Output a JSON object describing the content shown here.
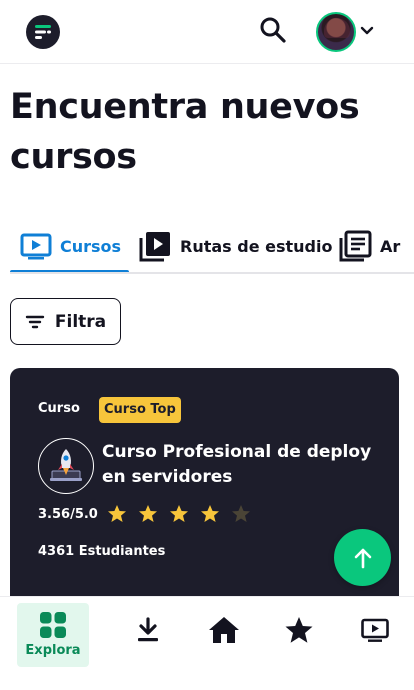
{
  "header": {
    "logo_icon": "platzi-logo-icon",
    "search_icon": "search-icon",
    "avatar_icon": "user-avatar",
    "chevron_icon": "chevron-down-icon"
  },
  "page": {
    "title": "Encuentra nuevos cursos"
  },
  "tabs": [
    {
      "label": "Cursos",
      "icon": "play-video-icon",
      "active": true
    },
    {
      "label": "Rutas de estudio",
      "icon": "playlist-icon",
      "active": false
    },
    {
      "label": "Ar",
      "icon": "articles-icon",
      "active": false
    }
  ],
  "filter": {
    "label": "Filtra",
    "icon": "filter-icon"
  },
  "course_card": {
    "type_label": "Curso",
    "badge": "Curso Top",
    "icon": "rocket-laptop-icon",
    "title": "Curso Profesional de deploy en servidores",
    "rating": "3.56/5.0",
    "stars": {
      "filled": 4,
      "total": 5
    },
    "students": "4361 Estudiantes"
  },
  "fab": {
    "icon": "arrow-up-icon"
  },
  "bottom_nav": {
    "active_label": "Explora",
    "items": [
      {
        "icon": "grid-apps-icon",
        "label": "Explora"
      },
      {
        "icon": "download-icon"
      },
      {
        "icon": "home-icon"
      },
      {
        "icon": "star-icon"
      },
      {
        "icon": "tv-play-icon"
      }
    ]
  },
  "colors": {
    "accent_blue": "#0f7fd6",
    "accent_green": "#0ac77d",
    "card_bg": "#1d1d2b",
    "badge_yellow": "#f7c53b",
    "star_yellow": "#f7c53b"
  }
}
